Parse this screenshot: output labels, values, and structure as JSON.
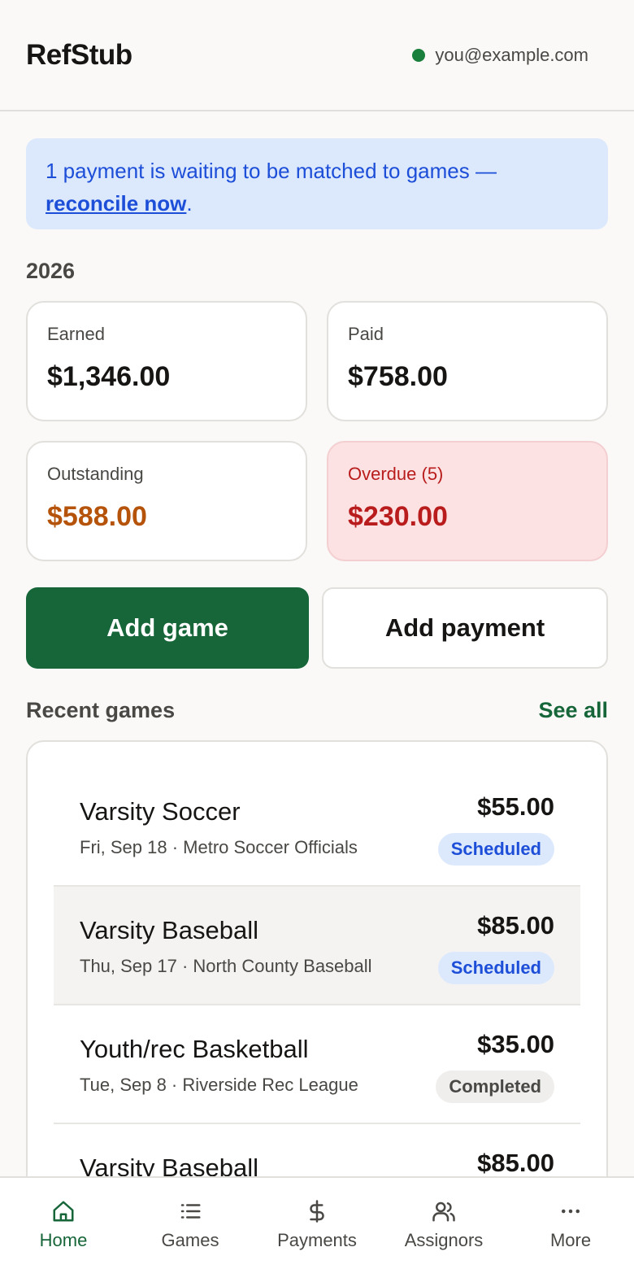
{
  "header": {
    "brand": "RefStub",
    "account_email": "you@example.com",
    "status_color": "#1a7f3c"
  },
  "banner": {
    "text": "1 payment is waiting to be matched to games — ",
    "link": "reconcile now",
    "suffix": "."
  },
  "summary": {
    "year": "2026",
    "cards": [
      {
        "label": "Earned",
        "amount": "$1,346.00"
      },
      {
        "label": "Paid",
        "amount": "$758.00"
      },
      {
        "label": "Outstanding",
        "amount": "$588.00"
      },
      {
        "label": "Overdue (5)",
        "amount": "$230.00"
      }
    ]
  },
  "actions": {
    "add_game": "Add game",
    "add_payment": "Add payment"
  },
  "recent": {
    "title": "Recent games",
    "see_all": "See all",
    "games": [
      {
        "title": "Varsity Soccer",
        "meta": "Fri, Sep 18 · Metro Soccer Officials",
        "amount": "$55.00",
        "status": "Scheduled"
      },
      {
        "title": "Varsity Baseball",
        "meta": "Thu, Sep 17 · North County Baseball",
        "amount": "$85.00",
        "status": "Scheduled"
      },
      {
        "title": "Youth/rec Basketball",
        "meta": "Tue, Sep 8 · Riverside Rec League",
        "amount": "$35.00",
        "status": "Completed"
      },
      {
        "title": "Varsity Baseball",
        "amount": "$85.00"
      }
    ]
  },
  "nav": {
    "items": [
      {
        "label": "Home",
        "icon": "home-icon"
      },
      {
        "label": "Games",
        "icon": "list-icon"
      },
      {
        "label": "Payments",
        "icon": "dollar-icon"
      },
      {
        "label": "Assignors",
        "icon": "people-icon"
      },
      {
        "label": "More",
        "icon": "more-icon"
      }
    ]
  },
  "colors": {
    "brand_green": "#17663a",
    "info_blue": "#1d4ed8",
    "warning_orange": "#b45309",
    "danger_red": "#b91c1c"
  }
}
